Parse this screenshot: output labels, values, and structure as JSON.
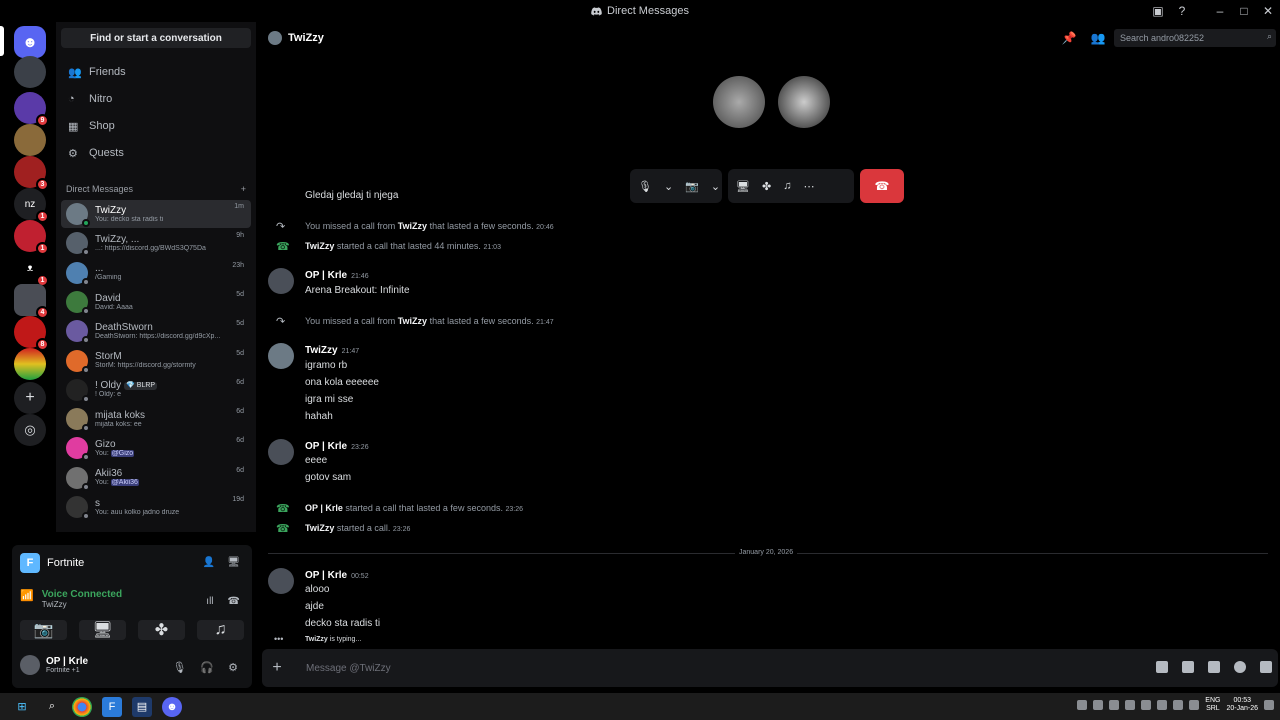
{
  "window": {
    "title": "Direct Messages"
  },
  "dm_sidebar": {
    "search_label": "Find or start a conversation",
    "nav": [
      {
        "label": "Friends",
        "icon": "friends-icon"
      },
      {
        "label": "Nitro",
        "icon": "nitro-icon"
      },
      {
        "label": "Shop",
        "icon": "shop-icon"
      },
      {
        "label": "Quests",
        "icon": "quests-icon"
      }
    ],
    "dm_header": "Direct Messages",
    "dms": [
      {
        "name": "TwiZzy",
        "sub": "You: decko sta radis ti",
        "time": "1m",
        "color": "#6c7a85"
      },
      {
        "name": "TwiZzy, ...",
        "sub": "...: https://discord.gg/BWdS3Q75Da",
        "time": "9h",
        "color": "#56606b"
      },
      {
        "name": "...",
        "sub": "/Gaming",
        "time": "23h",
        "color": "#4f80b0"
      },
      {
        "name": "David",
        "sub": "David: Aaaa",
        "time": "5d",
        "color": "#3d7a3d"
      },
      {
        "name": "DeathStworn",
        "sub": "DeathStworn: https://discord.gg/d9cXp...",
        "time": "5d",
        "color": "#6a5aa0"
      },
      {
        "name": "StorM",
        "sub": "StorM: https://discord.gg/stormty",
        "time": "5d",
        "color": "#e06a2a"
      },
      {
        "name": "! Oldy",
        "tag": "💎 BLRP",
        "sub": "! Oldy: e",
        "time": "6d",
        "color": "#222"
      },
      {
        "name": "mijata koks",
        "sub": "mijata koks: ee",
        "time": "6d",
        "color": "#8a7a5a"
      },
      {
        "name": "Gizo",
        "sub_prefix": "You: ",
        "sub_mention": "@Gizo",
        "time": "6d",
        "color": "#e03ca0"
      },
      {
        "name": "Akii36",
        "sub_prefix": "You: ",
        "sub_mention": "@Akii36",
        "time": "6d",
        "color": "#707070"
      },
      {
        "name": "s",
        "sub": "You: auu kolko jadno druze",
        "time": "19d",
        "color": "#333"
      }
    ]
  },
  "voice_panel": {
    "game": "Fortnite",
    "status": "Voice Connected",
    "channel": "TwiZzy"
  },
  "user_panel": {
    "name": "OP | Krle",
    "status": "Fortnite +1"
  },
  "channel": {
    "name": "TwiZzy",
    "search_placeholder": "Search andro082252"
  },
  "messages": {
    "top_line": "Gledaj gledaj ti njega",
    "sys1": {
      "pre": "You missed a call from ",
      "who": "TwiZzy",
      "post": " that lasted a few seconds.",
      "ts": "20:46"
    },
    "sys2": {
      "who": "TwiZzy",
      "post": " started a call that lasted 44 minutes.",
      "ts": "21:03"
    },
    "g1": {
      "author": "OP | Krle",
      "ts": "21:46",
      "lines": [
        "Arena Breakout: Infinite"
      ]
    },
    "sys3": {
      "pre": "You missed a call from ",
      "who": "TwiZzy",
      "post": " that lasted a few seconds.",
      "ts": "21:47"
    },
    "g2": {
      "author": "TwiZzy",
      "ts": "21:47",
      "lines": [
        "igramo rb",
        "ona kola eeeeee",
        "igra mi sse",
        "hahah"
      ]
    },
    "g3": {
      "author": "OP | Krle",
      "ts": "23:26",
      "lines": [
        "eeee",
        "gotov sam"
      ]
    },
    "sys4": {
      "who": "OP | Krle",
      "post": " started a call that lasted a few seconds.",
      "ts": "23:26"
    },
    "sys5": {
      "who": "TwiZzy",
      "post": " started a call.",
      "ts": "23:26"
    },
    "date_divider": "January 20, 2026",
    "g4": {
      "author": "OP | Krle",
      "ts": "00:52",
      "lines": [
        "alooo",
        "ajde",
        "decko sta radis ti"
      ]
    },
    "typing_who": "TwiZzy",
    "typing_text": " is typing..."
  },
  "composer": {
    "placeholder": "Message @TwiZzy"
  },
  "taskbar": {
    "lang": "ENG",
    "layout": "SRL",
    "time": "00:53",
    "date": "20-Jan-26"
  }
}
